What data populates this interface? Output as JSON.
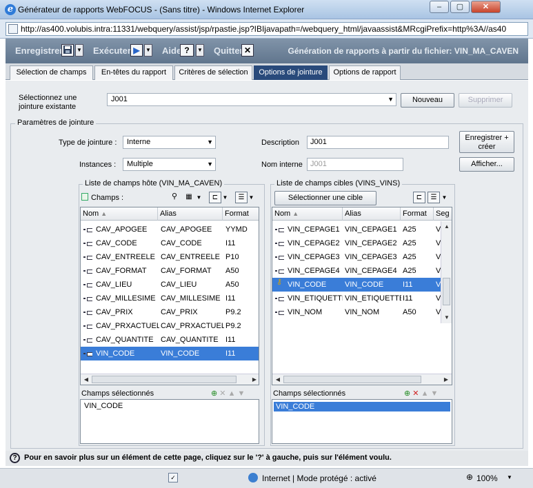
{
  "window": {
    "title": "Générateur de rapports WebFOCUS - (Sans titre) - Windows Internet Explorer",
    "url": "http://as400.volubis.intra:11331/webquery/assist/jsp/rpastie.jsp?IBIjavapath=/webquery_html/javaassist&MRcgiPrefix=http%3A//as40",
    "minimize": "–",
    "maximize": "▢",
    "close": "✕"
  },
  "toolbar": {
    "save_label": "Enregistrer",
    "run_label": "Exécuter",
    "help_label": "Aide",
    "help_icon": "?",
    "quit_label": "Quitter",
    "quit_icon": "✕",
    "save_icon": "floppy-icon",
    "app_title": "Génération de rapports à partir du fichier: VIN_MA_CAVEN"
  },
  "tabs": [
    {
      "label": "Sélection de champs"
    },
    {
      "label": "En-têtes du rapport"
    },
    {
      "label": "Critères de sélection"
    },
    {
      "label": "Options de jointure",
      "active": true
    },
    {
      "label": "Options de rapport"
    }
  ],
  "join": {
    "select_label": "Sélectionnez une jointure existante",
    "select_value": "J001",
    "new_button": "Nouveau",
    "delete_button": "Supprimer"
  },
  "params": {
    "legend": "Paramètres de jointure",
    "type_label": "Type de jointure :",
    "type_value": "Interne",
    "instances_label": "Instances :",
    "instances_value": "Multiple",
    "description_label": "Description",
    "description_value": "J001",
    "internal_name_label": "Nom interne",
    "internal_name_value": "J001",
    "save_create_button": "Enregistrer + créer",
    "show_button": "Afficher..."
  },
  "host": {
    "legend": "Liste de champs hôte (VIN_MA_CAVEN)",
    "fields_label": "Champs :",
    "columns": [
      "Nom",
      "Alias",
      "Format"
    ],
    "rows": [
      [
        "CAV_APOGEE",
        "CAV_APOGEE",
        "YYMD"
      ],
      [
        "CAV_CODE",
        "CAV_CODE",
        "I11"
      ],
      [
        "CAV_ENTREELE",
        "CAV_ENTREELE",
        "P10"
      ],
      [
        "CAV_FORMAT",
        "CAV_FORMAT",
        "A50"
      ],
      [
        "CAV_LIEU",
        "CAV_LIEU",
        "A50"
      ],
      [
        "CAV_MILLESIME",
        "CAV_MILLESIME",
        "I11"
      ],
      [
        "CAV_PRIX",
        "CAV_PRIX",
        "P9.2"
      ],
      [
        "CAV_PRXACTUEL",
        "CAV_PRXACTUEL",
        "P9.2"
      ],
      [
        "CAV_QUANTITE",
        "CAV_QUANTITE",
        "I11"
      ],
      [
        "VIN_CODE",
        "VIN_CODE",
        "I11"
      ]
    ],
    "selected_row": 9,
    "selected_label": "Champs sélectionnés",
    "selected_values": [
      "VIN_CODE"
    ]
  },
  "target": {
    "legend": "Liste de champs cibles (VINS_VINS)",
    "select_target_button": "Sélectionner une cible",
    "columns": [
      "Nom",
      "Alias",
      "Format",
      "Seg"
    ],
    "rows": [
      [
        "VIN_CEPAGE1",
        "VIN_CEPAGE1",
        "A25",
        "V"
      ],
      [
        "VIN_CEPAGE2",
        "VIN_CEPAGE2",
        "A25",
        "V"
      ],
      [
        "VIN_CEPAGE3",
        "VIN_CEPAGE3",
        "A25",
        "V"
      ],
      [
        "VIN_CEPAGE4",
        "VIN_CEPAGE4",
        "A25",
        "V"
      ],
      [
        "VIN_CODE",
        "VIN_CODE",
        "I11",
        "V"
      ],
      [
        "VIN_ETIQUETTE",
        "VIN_ETIQUETTE",
        "I11",
        "V"
      ],
      [
        "VIN_NOM",
        "VIN_NOM",
        "A50",
        "V"
      ]
    ],
    "selected_row": 4,
    "selected_label": "Champs sélectionnés",
    "selected_values": [
      "VIN_CODE"
    ]
  },
  "help": {
    "icon": "?",
    "text": "Pour en savoir plus sur un élément de cette page, cliquez sur le '?' à gauche, puis sur l'élément voulu."
  },
  "status": {
    "zone": "Internet | Mode protégé : activé",
    "zoom": "100%"
  }
}
